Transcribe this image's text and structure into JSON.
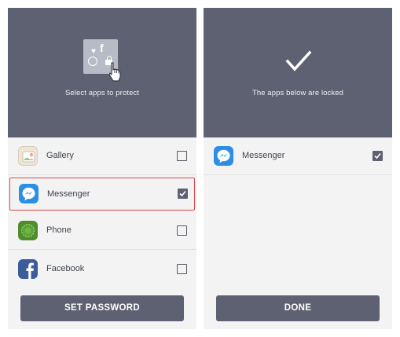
{
  "left_screen": {
    "caption": "Select apps to protect",
    "apps": [
      {
        "label": "Gallery",
        "icon": "gallery-icon",
        "checked": false
      },
      {
        "label": "Messenger",
        "icon": "messenger-icon",
        "checked": true
      },
      {
        "label": "Phone",
        "icon": "phone-icon",
        "checked": false
      },
      {
        "label": "Facebook",
        "icon": "facebook-icon",
        "checked": false
      }
    ],
    "button_label": "SET PASSWORD"
  },
  "right_screen": {
    "caption": "The apps below are locked",
    "apps": [
      {
        "label": "Messenger",
        "icon": "messenger-icon",
        "checked": true
      }
    ],
    "button_label": "DONE"
  },
  "colors": {
    "header": "#5d6171",
    "button": "#5d6171",
    "list_background": "#f3f3f3",
    "highlight_border": "#e0454a"
  }
}
